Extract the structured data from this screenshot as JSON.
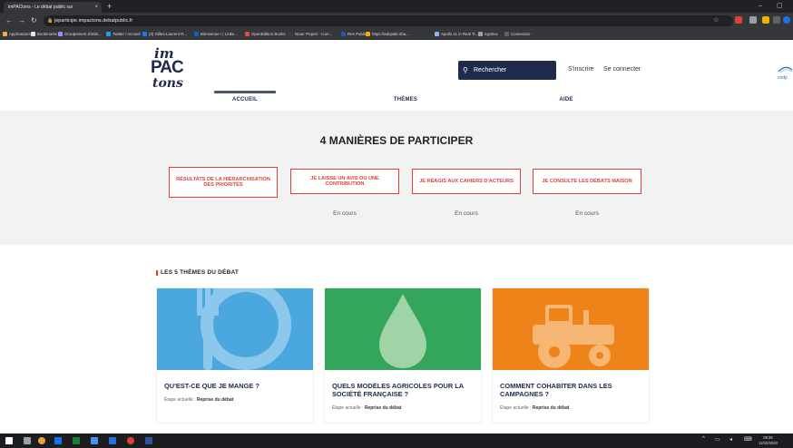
{
  "browser": {
    "tab_title": "imPACtons - Le débat public sur",
    "tab_close": "×",
    "new_tab": "+",
    "url": "jeparticipe.impactons.debatpublic.fr",
    "bookmarks": [
      {
        "label": "Applications",
        "color": "#e8b33a"
      },
      {
        "label": "Bookmarks",
        "color": "#e8eaed"
      },
      {
        "label": "Groupement d'intér...",
        "color": "#a58cf0"
      },
      {
        "label": "Twitter / Accueil",
        "color": "#1da1f2"
      },
      {
        "label": "(3) Gilles-Laurent R...",
        "color": "#1877f2"
      },
      {
        "label": "Bienvenue ! | Linke...",
        "color": "#0a66c2"
      },
      {
        "label": "OpenEdition Books",
        "color": "#e34b3b"
      },
      {
        "label": "Noun Project - Icon...",
        "color": "#3d3d3d"
      },
      {
        "label": "Res Publica",
        "color": "#2557a7"
      },
      {
        "label": "https://adopale.sha...",
        "color": "#f0b100"
      },
      {
        "label": "Apollo 11 in Real Ti...",
        "color": "#8ab4f8"
      },
      {
        "label": "egcBox",
        "color": "#9aa0a6"
      },
      {
        "label": "Connexion -",
        "color": "#5f6368"
      }
    ]
  },
  "header": {
    "logo_line1": "im",
    "logo_line2": "PAC",
    "logo_line3": "tons",
    "search_label": "Rechercher",
    "signup": "S'inscrire",
    "login": "Se connecter",
    "partner_logo": "cndp"
  },
  "nav": {
    "tabs": [
      {
        "label": "ACCUEIL"
      },
      {
        "label": "THÈMES"
      },
      {
        "label": "AIDE"
      }
    ]
  },
  "participer": {
    "title": "4 MANIÈRES DE PARTICIPER",
    "cards": [
      {
        "label": "RÉSULTATS DE LA HIÉRARCHISATION DES PRIORITÉS",
        "state": ""
      },
      {
        "label": "JE LAISSE UN AVIS OU UNE CONTRIBUTION",
        "state": "En cours"
      },
      {
        "label": "JE RÉAGIS AUX CAHIERS D'ACTEURS",
        "state": "En cours"
      },
      {
        "label": "JE CONSULTE LES DÉBATS MAISON",
        "state": "En cours"
      }
    ]
  },
  "themes": {
    "section_title": "LES 5 THÈMES DU DÉBAT",
    "cards": [
      {
        "title": "QU'EST-CE QUE JE MANGE ?",
        "step_label": "Étape actuelle : ",
        "step_value": "Reprise du débat",
        "color": "#4aa8df",
        "icon": "plate-fork-icon"
      },
      {
        "title": "QUELS MODÈLES AGRICOLES POUR LA SOCIÉTÉ FRANÇAISE ?",
        "step_label": "Étape actuelle : ",
        "step_value": "Reprise du débat",
        "color": "#33a65c",
        "icon": "water-drop-icon"
      },
      {
        "title": "COMMENT COHABITER DANS LES CAMPAGNES ?",
        "step_label": "Étape actuelle : ",
        "step_value": "Reprise du débat",
        "color": "#ee8319",
        "icon": "tractor-icon"
      }
    ]
  },
  "taskbar": {
    "time": "08:35",
    "date": "12/10/2020"
  },
  "colors": {
    "brand_navy": "#1f2a4d",
    "accent_red": "#e1403a"
  }
}
